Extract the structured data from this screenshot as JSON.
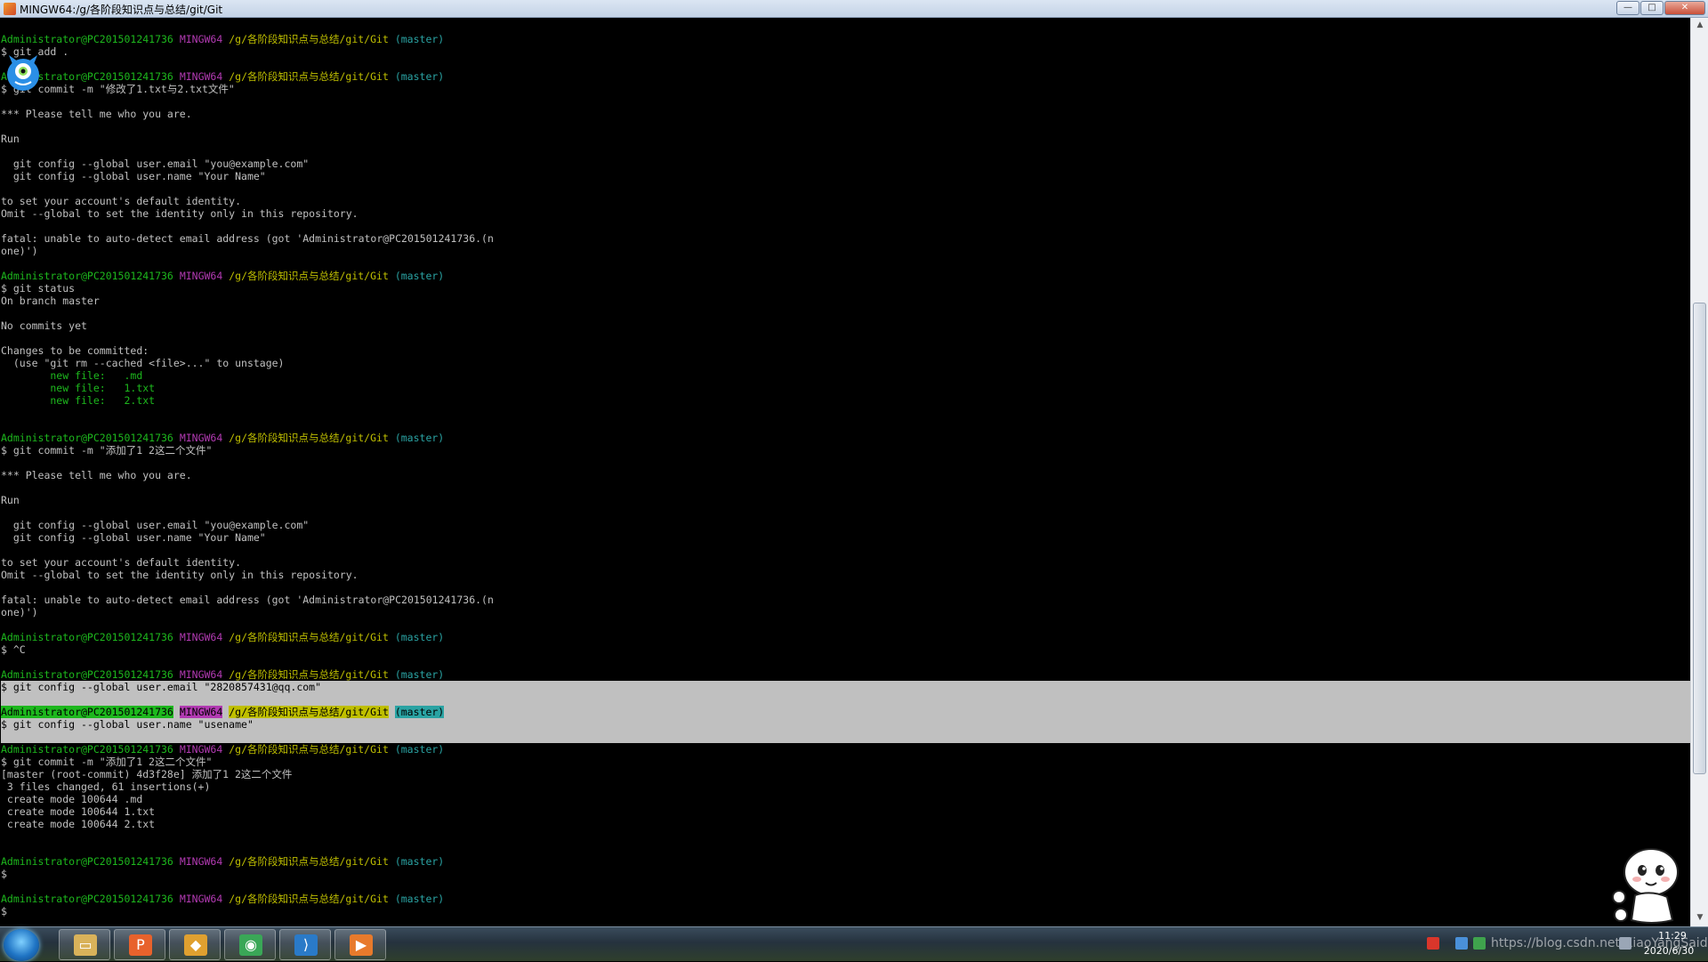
{
  "window": {
    "title": "MINGW64:/g/各阶段知识点与总结/git/Git",
    "minimize_glyph": "—",
    "maximize_glyph": "□",
    "close_glyph": "✕"
  },
  "prompt": {
    "user": "Administrator@PC201501241736",
    "host": "MINGW64",
    "path": "/g/各阶段知识点与总结/git/Git",
    "branch": "(master)"
  },
  "terminal_lines": [
    {
      "kind": "prompt"
    },
    {
      "kind": "text",
      "text": "$ git add ."
    },
    {
      "kind": "blank"
    },
    {
      "kind": "prompt"
    },
    {
      "kind": "text",
      "text": "$ git commit -m \"修改了1.txt与2.txt文件\""
    },
    {
      "kind": "blank"
    },
    {
      "kind": "text",
      "text": "*** Please tell me who you are."
    },
    {
      "kind": "blank"
    },
    {
      "kind": "text",
      "text": "Run"
    },
    {
      "kind": "blank"
    },
    {
      "kind": "text",
      "text": "  git config --global user.email \"you@example.com\""
    },
    {
      "kind": "text",
      "text": "  git config --global user.name \"Your Name\""
    },
    {
      "kind": "blank"
    },
    {
      "kind": "text",
      "text": "to set your account's default identity."
    },
    {
      "kind": "text",
      "text": "Omit --global to set the identity only in this repository."
    },
    {
      "kind": "blank"
    },
    {
      "kind": "text",
      "text": "fatal: unable to auto-detect email address (got 'Administrator@PC201501241736.(n"
    },
    {
      "kind": "text",
      "text": "one)')"
    },
    {
      "kind": "blank"
    },
    {
      "kind": "prompt"
    },
    {
      "kind": "text",
      "text": "$ git status"
    },
    {
      "kind": "text",
      "text": "On branch master"
    },
    {
      "kind": "blank"
    },
    {
      "kind": "text",
      "text": "No commits yet"
    },
    {
      "kind": "blank"
    },
    {
      "kind": "text",
      "text": "Changes to be committed:"
    },
    {
      "kind": "text",
      "text": "  (use \"git rm --cached <file>...\" to unstage)"
    },
    {
      "kind": "green",
      "text": "        new file:   .md"
    },
    {
      "kind": "green",
      "text": "        new file:   1.txt"
    },
    {
      "kind": "green",
      "text": "        new file:   2.txt"
    },
    {
      "kind": "blank"
    },
    {
      "kind": "blank"
    },
    {
      "kind": "prompt"
    },
    {
      "kind": "text",
      "text": "$ git commit -m \"添加了1 2这二个文件\""
    },
    {
      "kind": "blank"
    },
    {
      "kind": "text",
      "text": "*** Please tell me who you are."
    },
    {
      "kind": "blank"
    },
    {
      "kind": "text",
      "text": "Run"
    },
    {
      "kind": "blank"
    },
    {
      "kind": "text",
      "text": "  git config --global user.email \"you@example.com\""
    },
    {
      "kind": "text",
      "text": "  git config --global user.name \"Your Name\""
    },
    {
      "kind": "blank"
    },
    {
      "kind": "text",
      "text": "to set your account's default identity."
    },
    {
      "kind": "text",
      "text": "Omit --global to set the identity only in this repository."
    },
    {
      "kind": "blank"
    },
    {
      "kind": "text",
      "text": "fatal: unable to auto-detect email address (got 'Administrator@PC201501241736.(n"
    },
    {
      "kind": "text",
      "text": "one)')"
    },
    {
      "kind": "blank"
    },
    {
      "kind": "prompt"
    },
    {
      "kind": "text",
      "text": "$ ^C"
    },
    {
      "kind": "blank"
    },
    {
      "kind": "prompt"
    },
    {
      "kind": "text",
      "text": "$ git config --global user.email \"2820857431@qq.com\"",
      "selected": true
    },
    {
      "kind": "blank",
      "selected": true
    },
    {
      "kind": "prompt",
      "selected": true
    },
    {
      "kind": "text",
      "text": "$ git config --global user.name \"usename\"",
      "selected": true
    },
    {
      "kind": "blank",
      "selected": true
    },
    {
      "kind": "prompt"
    },
    {
      "kind": "text",
      "text": "$ git commit -m \"添加了1 2这二个文件\""
    },
    {
      "kind": "text",
      "text": "[master (root-commit) 4d3f28e] 添加了1 2这二个文件"
    },
    {
      "kind": "text",
      "text": " 3 files changed, 61 insertions(+)"
    },
    {
      "kind": "text",
      "text": " create mode 100644 .md"
    },
    {
      "kind": "text",
      "text": " create mode 100644 1.txt"
    },
    {
      "kind": "text",
      "text": " create mode 100644 2.txt"
    },
    {
      "kind": "blank"
    },
    {
      "kind": "blank"
    },
    {
      "kind": "prompt"
    },
    {
      "kind": "text",
      "text": "$"
    },
    {
      "kind": "blank"
    },
    {
      "kind": "prompt"
    },
    {
      "kind": "text",
      "text": "$"
    }
  ],
  "scrollbar": {
    "up_glyph": "▲",
    "down_glyph": "▼",
    "thumb_fraction": 0.54
  },
  "taskbar": {
    "apps": [
      {
        "name": "file-explorer",
        "glyph": "▭",
        "color": "#d9b25a"
      },
      {
        "name": "wps-presentation",
        "glyph": "P",
        "color": "#e8622c"
      },
      {
        "name": "git-tool",
        "glyph": "◆",
        "color": "#e0a030"
      },
      {
        "name": "chrome",
        "glyph": "◉",
        "color": "#3aa757"
      },
      {
        "name": "visual-studio-code",
        "glyph": "⟩",
        "color": "#2a7ac8"
      },
      {
        "name": "media-player",
        "glyph": "▶",
        "color": "#e87a2c"
      }
    ],
    "tray_url": "https://blog.csdn.net/XiaoYangSaid",
    "clock_time": "11:29",
    "clock_date": "2020/6/30"
  }
}
